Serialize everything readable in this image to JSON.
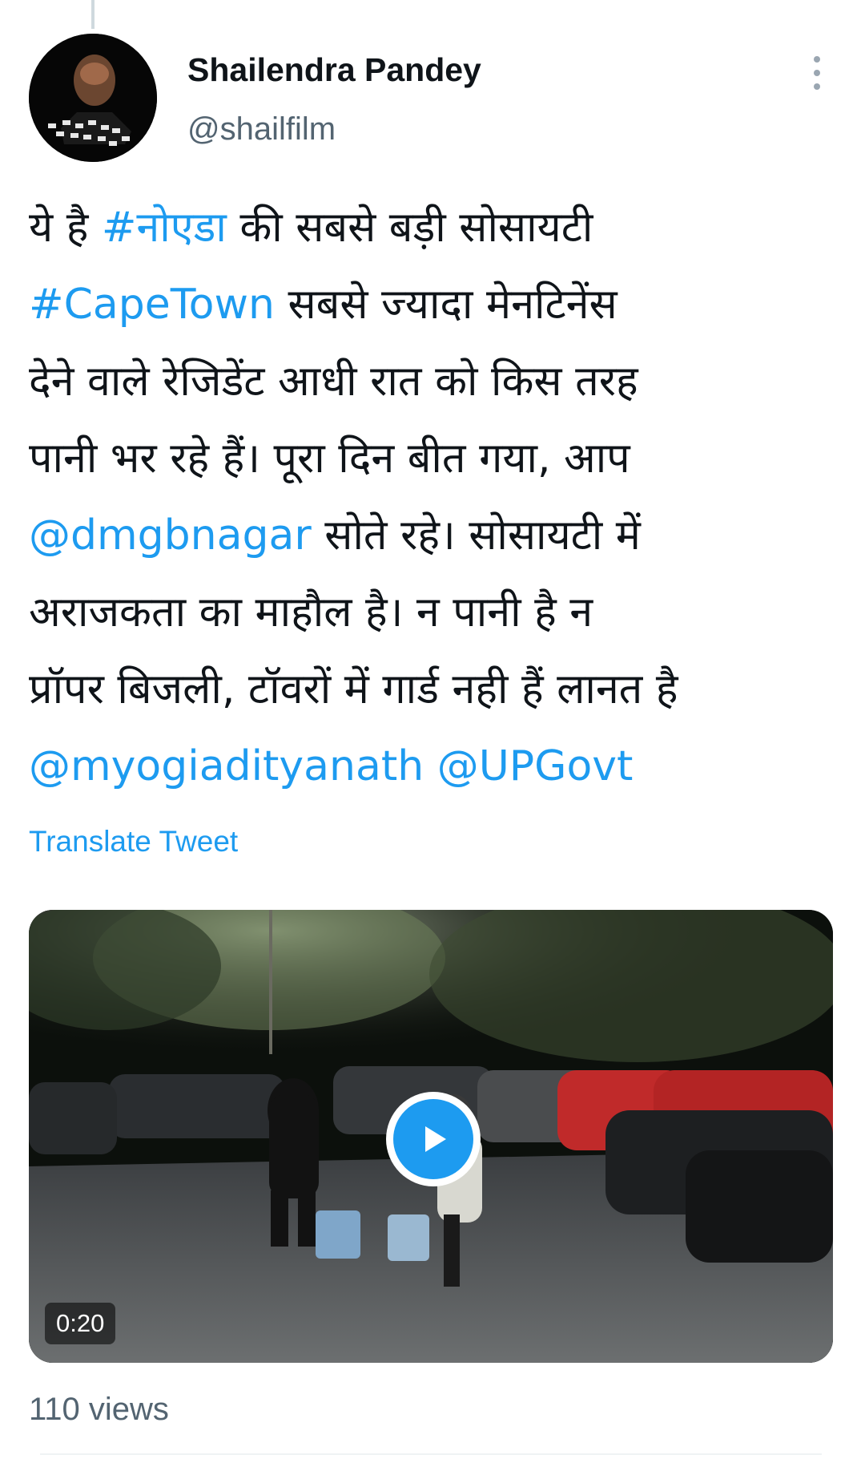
{
  "author": {
    "display_name": "Shailendra Pandey",
    "handle": "@shailfilm"
  },
  "tweet": {
    "lines": [
      [
        {
          "text": "ये है ",
          "link": false
        },
        {
          "text": "#नोएडा",
          "link": true
        },
        {
          "text": " की सबसे बड़ी सोसायटी",
          "link": false
        }
      ],
      [
        {
          "text": "#CapeTown",
          "link": true
        },
        {
          "text": " सबसे ज्यादा मेनटिनेंस",
          "link": false
        }
      ],
      [
        {
          "text": "देने वाले रेजिडेंट आधी रात को किस तरह",
          "link": false
        }
      ],
      [
        {
          "text": "पानी भर रहे हैं। पूरा दिन बीत गया, आप",
          "link": false
        }
      ],
      [
        {
          "text": "@dmgbnagar",
          "link": true
        },
        {
          "text": " सोते रहे। सोसायटी में",
          "link": false
        }
      ],
      [
        {
          "text": "अराजकता का माहौल है। न पानी है न",
          "link": false
        }
      ],
      [
        {
          "text": "प्रॉपर बिजली, टॉवरों में गार्ड नही हैं लानत है",
          "link": false
        }
      ],
      [
        {
          "text": "@myogiadityanath",
          "link": true
        },
        {
          "text": " ",
          "link": false
        },
        {
          "text": "@UPGovt",
          "link": true
        }
      ]
    ],
    "translate_label": "Translate Tweet"
  },
  "media": {
    "duration": "0:20",
    "play_icon": "play-icon"
  },
  "views_label": "110 views",
  "colors": {
    "link": "#1d9bf0",
    "text": "#0f1419",
    "secondary": "#536471"
  }
}
